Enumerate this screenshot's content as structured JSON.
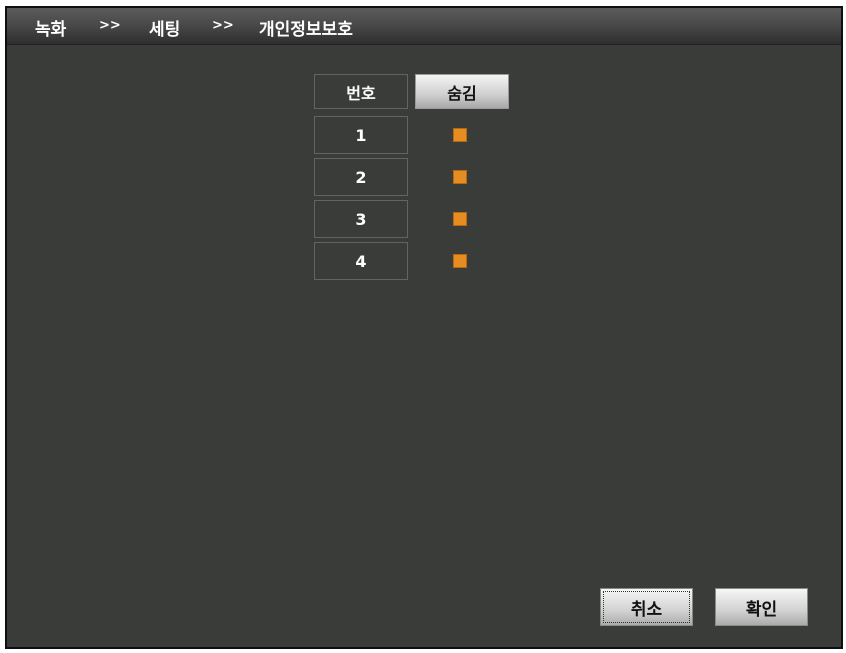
{
  "breadcrumb": {
    "items": [
      "녹화",
      "세팅",
      "개인정보보호"
    ],
    "separator": ">>"
  },
  "table": {
    "headers": {
      "number": "번호",
      "hide": "숨김"
    },
    "rows": [
      {
        "number": "1",
        "hide": true
      },
      {
        "number": "2",
        "hide": true
      },
      {
        "number": "3",
        "hide": true
      },
      {
        "number": "4",
        "hide": true
      }
    ]
  },
  "buttons": {
    "cancel": "취소",
    "ok": "확인"
  },
  "colors": {
    "background": "#3a3c39",
    "checkbox": "#e58d22"
  }
}
